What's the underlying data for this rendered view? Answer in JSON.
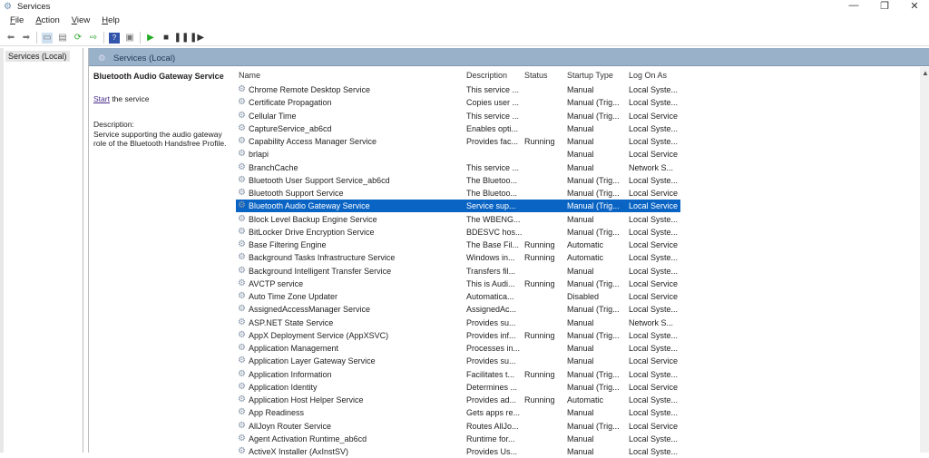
{
  "window": {
    "title": "Services",
    "minimize": "—",
    "maximize": "❐",
    "close": "✕"
  },
  "menu": [
    "File",
    "Action",
    "View",
    "Help"
  ],
  "tree": {
    "root": "Services (Local)"
  },
  "panel": {
    "title": "Services (Local)"
  },
  "detail": {
    "title": "Bluetooth Audio Gateway Service",
    "start_link": "Start",
    "start_rest": " the service",
    "desc_label": "Description:",
    "desc": "Service supporting the audio gateway role of the Bluetooth Handsfree Profile."
  },
  "columns": [
    "Name",
    "Description",
    "Status",
    "Startup Type",
    "Log On As"
  ],
  "selected_index": 9,
  "rows": [
    [
      "Chrome Remote Desktop Service",
      "This service ...",
      "",
      "Manual",
      "Local Syste..."
    ],
    [
      "Certificate Propagation",
      "Copies user ...",
      "",
      "Manual (Trig...",
      "Local Syste..."
    ],
    [
      "Cellular Time",
      "This service ...",
      "",
      "Manual (Trig...",
      "Local Service"
    ],
    [
      "CaptureService_ab6cd",
      "Enables opti...",
      "",
      "Manual",
      "Local Syste..."
    ],
    [
      "Capability Access Manager Service",
      "Provides fac...",
      "Running",
      "Manual",
      "Local Syste..."
    ],
    [
      "brlapi",
      "",
      "",
      "Manual",
      "Local Service"
    ],
    [
      "BranchCache",
      "This service ...",
      "",
      "Manual",
      "Network S..."
    ],
    [
      "Bluetooth User Support Service_ab6cd",
      "The Bluetoo...",
      "",
      "Manual (Trig...",
      "Local Syste..."
    ],
    [
      "Bluetooth Support Service",
      "The Bluetoo...",
      "",
      "Manual (Trig...",
      "Local Service"
    ],
    [
      "Bluetooth Audio Gateway Service",
      "Service sup...",
      "",
      "Manual (Trig...",
      "Local Service"
    ],
    [
      "Block Level Backup Engine Service",
      "The WBENG...",
      "",
      "Manual",
      "Local Syste..."
    ],
    [
      "BitLocker Drive Encryption Service",
      "BDESVC hos...",
      "",
      "Manual (Trig...",
      "Local Syste..."
    ],
    [
      "Base Filtering Engine",
      "The Base Fil...",
      "Running",
      "Automatic",
      "Local Service"
    ],
    [
      "Background Tasks Infrastructure Service",
      "Windows in...",
      "Running",
      "Automatic",
      "Local Syste..."
    ],
    [
      "Background Intelligent Transfer Service",
      "Transfers fil...",
      "",
      "Manual",
      "Local Syste..."
    ],
    [
      "AVCTP service",
      "This is Audi...",
      "Running",
      "Manual (Trig...",
      "Local Service"
    ],
    [
      "Auto Time Zone Updater",
      "Automatica...",
      "",
      "Disabled",
      "Local Service"
    ],
    [
      "AssignedAccessManager Service",
      "AssignedAc...",
      "",
      "Manual (Trig...",
      "Local Syste..."
    ],
    [
      "ASP.NET State Service",
      "Provides su...",
      "",
      "Manual",
      "Network S..."
    ],
    [
      "AppX Deployment Service (AppXSVC)",
      "Provides inf...",
      "Running",
      "Manual (Trig...",
      "Local Syste..."
    ],
    [
      "Application Management",
      "Processes in...",
      "",
      "Manual",
      "Local Syste..."
    ],
    [
      "Application Layer Gateway Service",
      "Provides su...",
      "",
      "Manual",
      "Local Service"
    ],
    [
      "Application Information",
      "Facilitates t...",
      "Running",
      "Manual (Trig...",
      "Local Syste..."
    ],
    [
      "Application Identity",
      "Determines ...",
      "",
      "Manual (Trig...",
      "Local Service"
    ],
    [
      "Application Host Helper Service",
      "Provides ad...",
      "Running",
      "Automatic",
      "Local Syste..."
    ],
    [
      "App Readiness",
      "Gets apps re...",
      "",
      "Manual",
      "Local Syste..."
    ],
    [
      "AllJoyn Router Service",
      "Routes AllJo...",
      "",
      "Manual (Trig...",
      "Local Service"
    ],
    [
      "Agent Activation Runtime_ab6cd",
      "Runtime for...",
      "",
      "Manual",
      "Local Syste..."
    ],
    [
      "ActiveX Installer (AxInstSV)",
      "Provides Us...",
      "",
      "Manual",
      "Local Syste..."
    ]
  ]
}
